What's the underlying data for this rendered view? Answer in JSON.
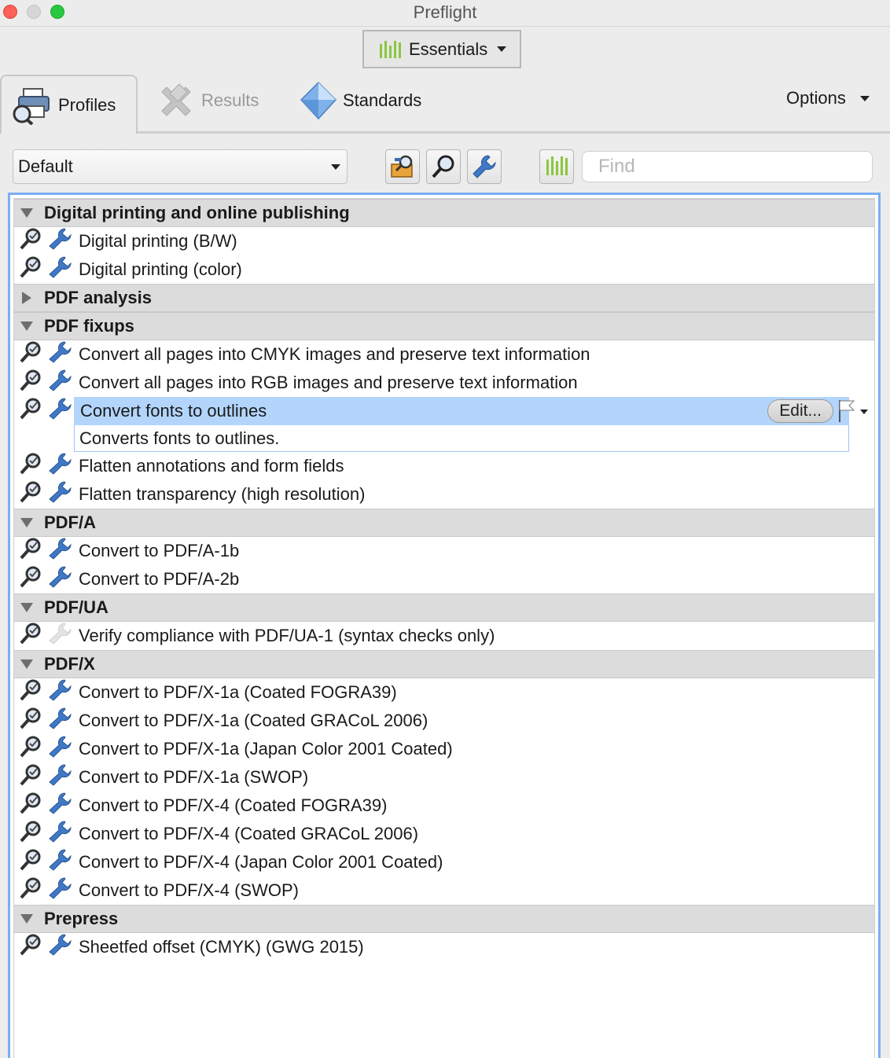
{
  "window": {
    "title": "Preflight"
  },
  "workspace": {
    "label": "Essentials"
  },
  "tabs": {
    "profiles": "Profiles",
    "results": "Results",
    "standards": "Standards",
    "options": "Options"
  },
  "toolbar": {
    "profile_select": "Default",
    "find_placeholder": "Find"
  },
  "groups": [
    {
      "name": "Digital printing and online publishing",
      "expanded": true,
      "items": [
        {
          "label": "Digital printing (B/W)"
        },
        {
          "label": "Digital printing (color)"
        }
      ]
    },
    {
      "name": "PDF analysis",
      "expanded": false,
      "items": []
    },
    {
      "name": "PDF fixups",
      "expanded": true,
      "items": [
        {
          "label": "Convert all pages into CMYK images and preserve text information"
        },
        {
          "label": "Convert all pages into RGB images and preserve text information"
        },
        {
          "label": "Convert fonts to outlines",
          "selected": true,
          "description": "Converts fonts to outlines.",
          "edit_label": "Edit..."
        },
        {
          "label": "Flatten annotations and form fields"
        },
        {
          "label": "Flatten transparency (high resolution)"
        }
      ]
    },
    {
      "name": "PDF/A",
      "expanded": true,
      "items": [
        {
          "label": "Convert to PDF/A-1b"
        },
        {
          "label": "Convert to PDF/A-2b"
        }
      ]
    },
    {
      "name": "PDF/UA",
      "expanded": true,
      "items": [
        {
          "label": "Verify compliance with PDF/UA-1 (syntax checks only)",
          "wrench_disabled": true
        }
      ]
    },
    {
      "name": "PDF/X",
      "expanded": true,
      "items": [
        {
          "label": "Convert to PDF/X-1a (Coated FOGRA39)"
        },
        {
          "label": "Convert to PDF/X-1a (Coated GRACoL 2006)"
        },
        {
          "label": "Convert to PDF/X-1a (Japan Color 2001 Coated)"
        },
        {
          "label": "Convert to PDF/X-1a (SWOP)"
        },
        {
          "label": "Convert to PDF/X-4 (Coated FOGRA39)"
        },
        {
          "label": "Convert to PDF/X-4 (Coated GRACoL 2006)"
        },
        {
          "label": "Convert to PDF/X-4 (Japan Color 2001 Coated)"
        },
        {
          "label": "Convert to PDF/X-4 (SWOP)"
        }
      ]
    },
    {
      "name": "Prepress",
      "expanded": true,
      "items": [
        {
          "label": "Sheetfed offset (CMYK) (GWG 2015)"
        }
      ]
    }
  ],
  "colors": {
    "selection": "#b3d5fc",
    "accent_border": "#7aaef4",
    "essentials_green": "#8cc63f",
    "wrench_blue": "#3f78c8"
  }
}
